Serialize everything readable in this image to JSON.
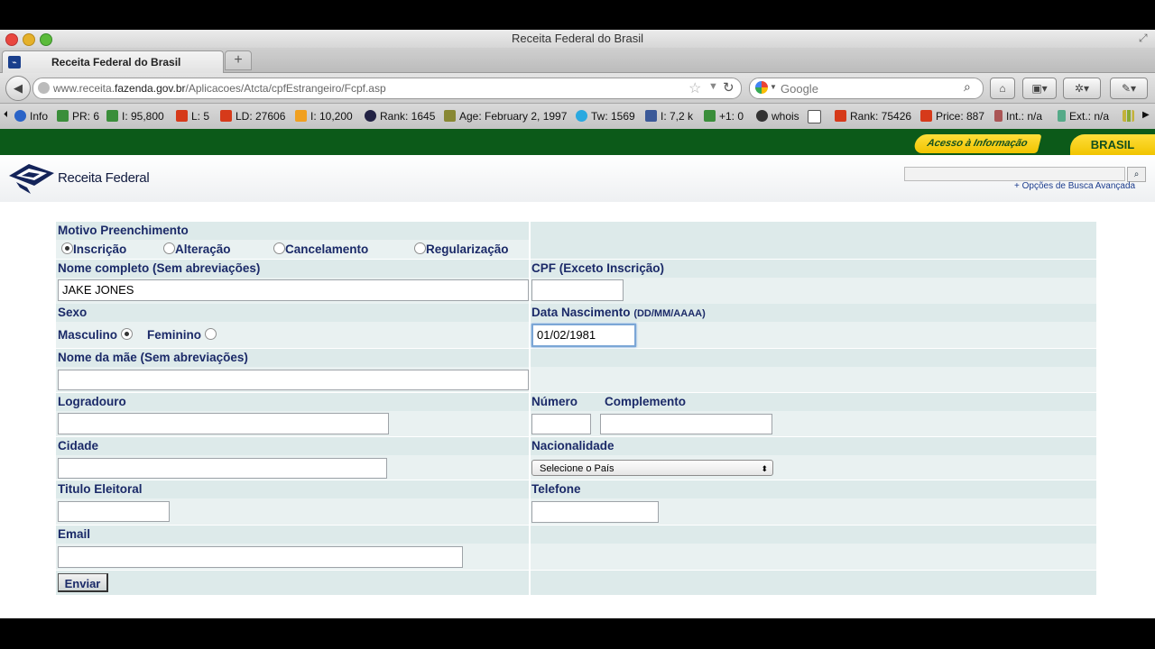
{
  "window": {
    "title": "Receita Federal do Brasil"
  },
  "tab": {
    "label": "Receita Federal do Brasil",
    "new_tab": "+"
  },
  "nav": {
    "url_prefix": "www.receita.",
    "url_domain": "fazenda.gov.br",
    "url_path": "/Aplicacoes/Atcta/cpfEstrangeiro/Fcpf.asp",
    "search_placeholder": "Google"
  },
  "extensions": [
    {
      "label": "Info",
      "color": "#2a63c7"
    },
    {
      "label": "PR: 6",
      "color": "#3a8e3a"
    },
    {
      "label": "I: 95,800",
      "color": "#3a8e3a"
    },
    {
      "label": "L: 5",
      "color": "#d63a1a"
    },
    {
      "label": "LD: 27606",
      "color": "#d63a1a"
    },
    {
      "label": "I: 10,200",
      "color": "#f0a020"
    },
    {
      "label": "Rank: 1645",
      "color": "#224"
    },
    {
      "label": "Age: February 2, 1997",
      "color": "#883"
    },
    {
      "label": "Tw: 1569",
      "color": "#2aa9e0"
    },
    {
      "label": "I: 7,2 k",
      "color": "#3b5998"
    },
    {
      "label": "+1: 0",
      "color": "#3a8e3a"
    },
    {
      "label": "whois",
      "color": "#333"
    },
    {
      "label": "",
      "color": "#555"
    },
    {
      "label": "Rank: 75426",
      "color": "#d63a1a"
    },
    {
      "label": "Price: 887",
      "color": "#d63a1a"
    },
    {
      "label": "Int.: n/a",
      "color": "#a55"
    },
    {
      "label": "Ext.: n/a",
      "color": "#5a8"
    }
  ],
  "gov": {
    "acesso": "Acesso à Informação",
    "brasil": "BRASIL"
  },
  "header": {
    "logo": "Receita Federal",
    "busca_link": "+ Opções de Busca Avançada"
  },
  "form": {
    "motivo_label": "Motivo Preenchimento",
    "motivo_options": [
      "Inscrição",
      "Alteração",
      "Cancelamento",
      "Regularização"
    ],
    "motivo_selected": "Inscrição",
    "nome_label": "Nome completo (Sem abreviações)",
    "nome_value": "JAKE JONES",
    "cpf_label": "CPF (Exceto Inscrição)",
    "cpf_value": "",
    "sexo_label": "Sexo",
    "sexo_masc": "Masculino",
    "sexo_fem": "Feminino",
    "sexo_selected": "Masculino",
    "nasc_label": "Data Nascimento",
    "nasc_hint": "(DD/MM/AAAA)",
    "nasc_value": "01/02/1981",
    "mae_label": "Nome da mãe (Sem abreviações)",
    "mae_value": "",
    "logradouro_label": "Logradouro",
    "numero_label": "Número",
    "complemento_label": "Complemento",
    "cidade_label": "Cidade",
    "nacionalidade_label": "Nacionalidade",
    "nacionalidade_value": "Selecione o País",
    "titulo_label": "Titulo Eleitoral",
    "telefone_label": "Telefone",
    "email_label": "Email",
    "submit_label": "Enviar"
  }
}
